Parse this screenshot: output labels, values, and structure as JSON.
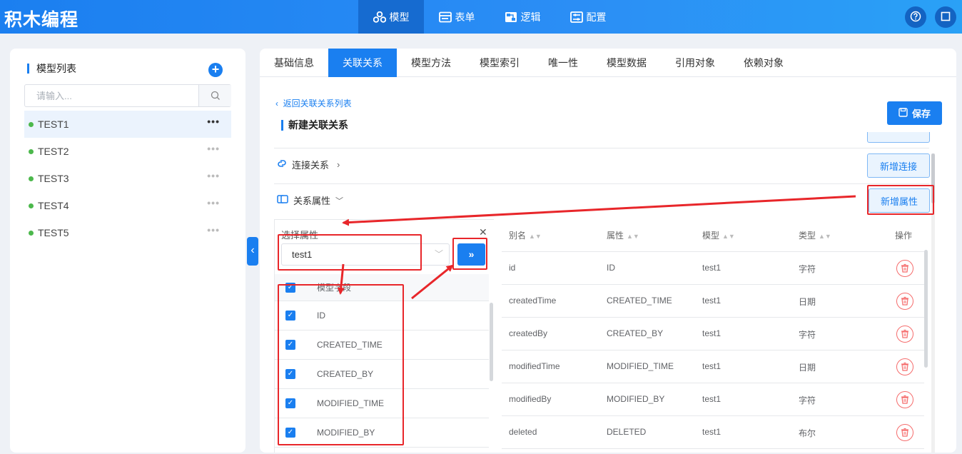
{
  "app": {
    "title": "积木编程"
  },
  "nav": [
    {
      "label": "模型",
      "icon": "model-icon",
      "active": true
    },
    {
      "label": "表单",
      "icon": "form-icon",
      "active": false
    },
    {
      "label": "逻辑",
      "icon": "logic-icon",
      "active": false
    },
    {
      "label": "配置",
      "icon": "config-icon",
      "active": false
    }
  ],
  "sidebar": {
    "title": "模型列表",
    "add_label": "+",
    "search_placeholder": "请输入...",
    "items": [
      {
        "label": "TEST1",
        "more": "•••"
      },
      {
        "label": "TEST2",
        "more": "•••"
      },
      {
        "label": "TEST3",
        "more": "•••"
      },
      {
        "label": "TEST4",
        "more": "•••"
      },
      {
        "label": "TEST5",
        "more": "•••"
      }
    ]
  },
  "tabs": [
    "基础信息",
    "关联关系",
    "模型方法",
    "模型索引",
    "唯一性",
    "模型数据",
    "引用对象",
    "依赖对象"
  ],
  "detail": {
    "back_link": "返回关联关系列表",
    "save_label": "保存",
    "section_title": "新建关联关系",
    "connection_label": "连接关系",
    "add_connection_label": "新增连接",
    "attributes_label": "关系属性",
    "add_attribute_label": "新增属性"
  },
  "selector": {
    "title": "选择属性",
    "dropdown_value": "test1",
    "go_label": "»",
    "header": "模型字段",
    "fields": [
      "ID",
      "CREATED_TIME",
      "CREATED_BY",
      "MODIFIED_TIME",
      "MODIFIED_BY"
    ]
  },
  "table": {
    "headers": {
      "alias": "别名",
      "attr": "属性",
      "model": "模型",
      "type": "类型",
      "action": "操作"
    },
    "rows": [
      {
        "alias": "id",
        "attr": "ID",
        "model": "test1",
        "type": "字符"
      },
      {
        "alias": "createdTime",
        "attr": "CREATED_TIME",
        "model": "test1",
        "type": "日期"
      },
      {
        "alias": "createdBy",
        "attr": "CREATED_BY",
        "model": "test1",
        "type": "字符"
      },
      {
        "alias": "modifiedTime",
        "attr": "MODIFIED_TIME",
        "model": "test1",
        "type": "日期"
      },
      {
        "alias": "modifiedBy",
        "attr": "MODIFIED_BY",
        "model": "test1",
        "type": "字符"
      },
      {
        "alias": "deleted",
        "attr": "DELETED",
        "model": "test1",
        "type": "布尔"
      }
    ]
  },
  "colors": {
    "primary": "#1a7ff0",
    "annotation": "#e8262a",
    "danger": "#f56c6c",
    "online": "#4cb84c"
  }
}
